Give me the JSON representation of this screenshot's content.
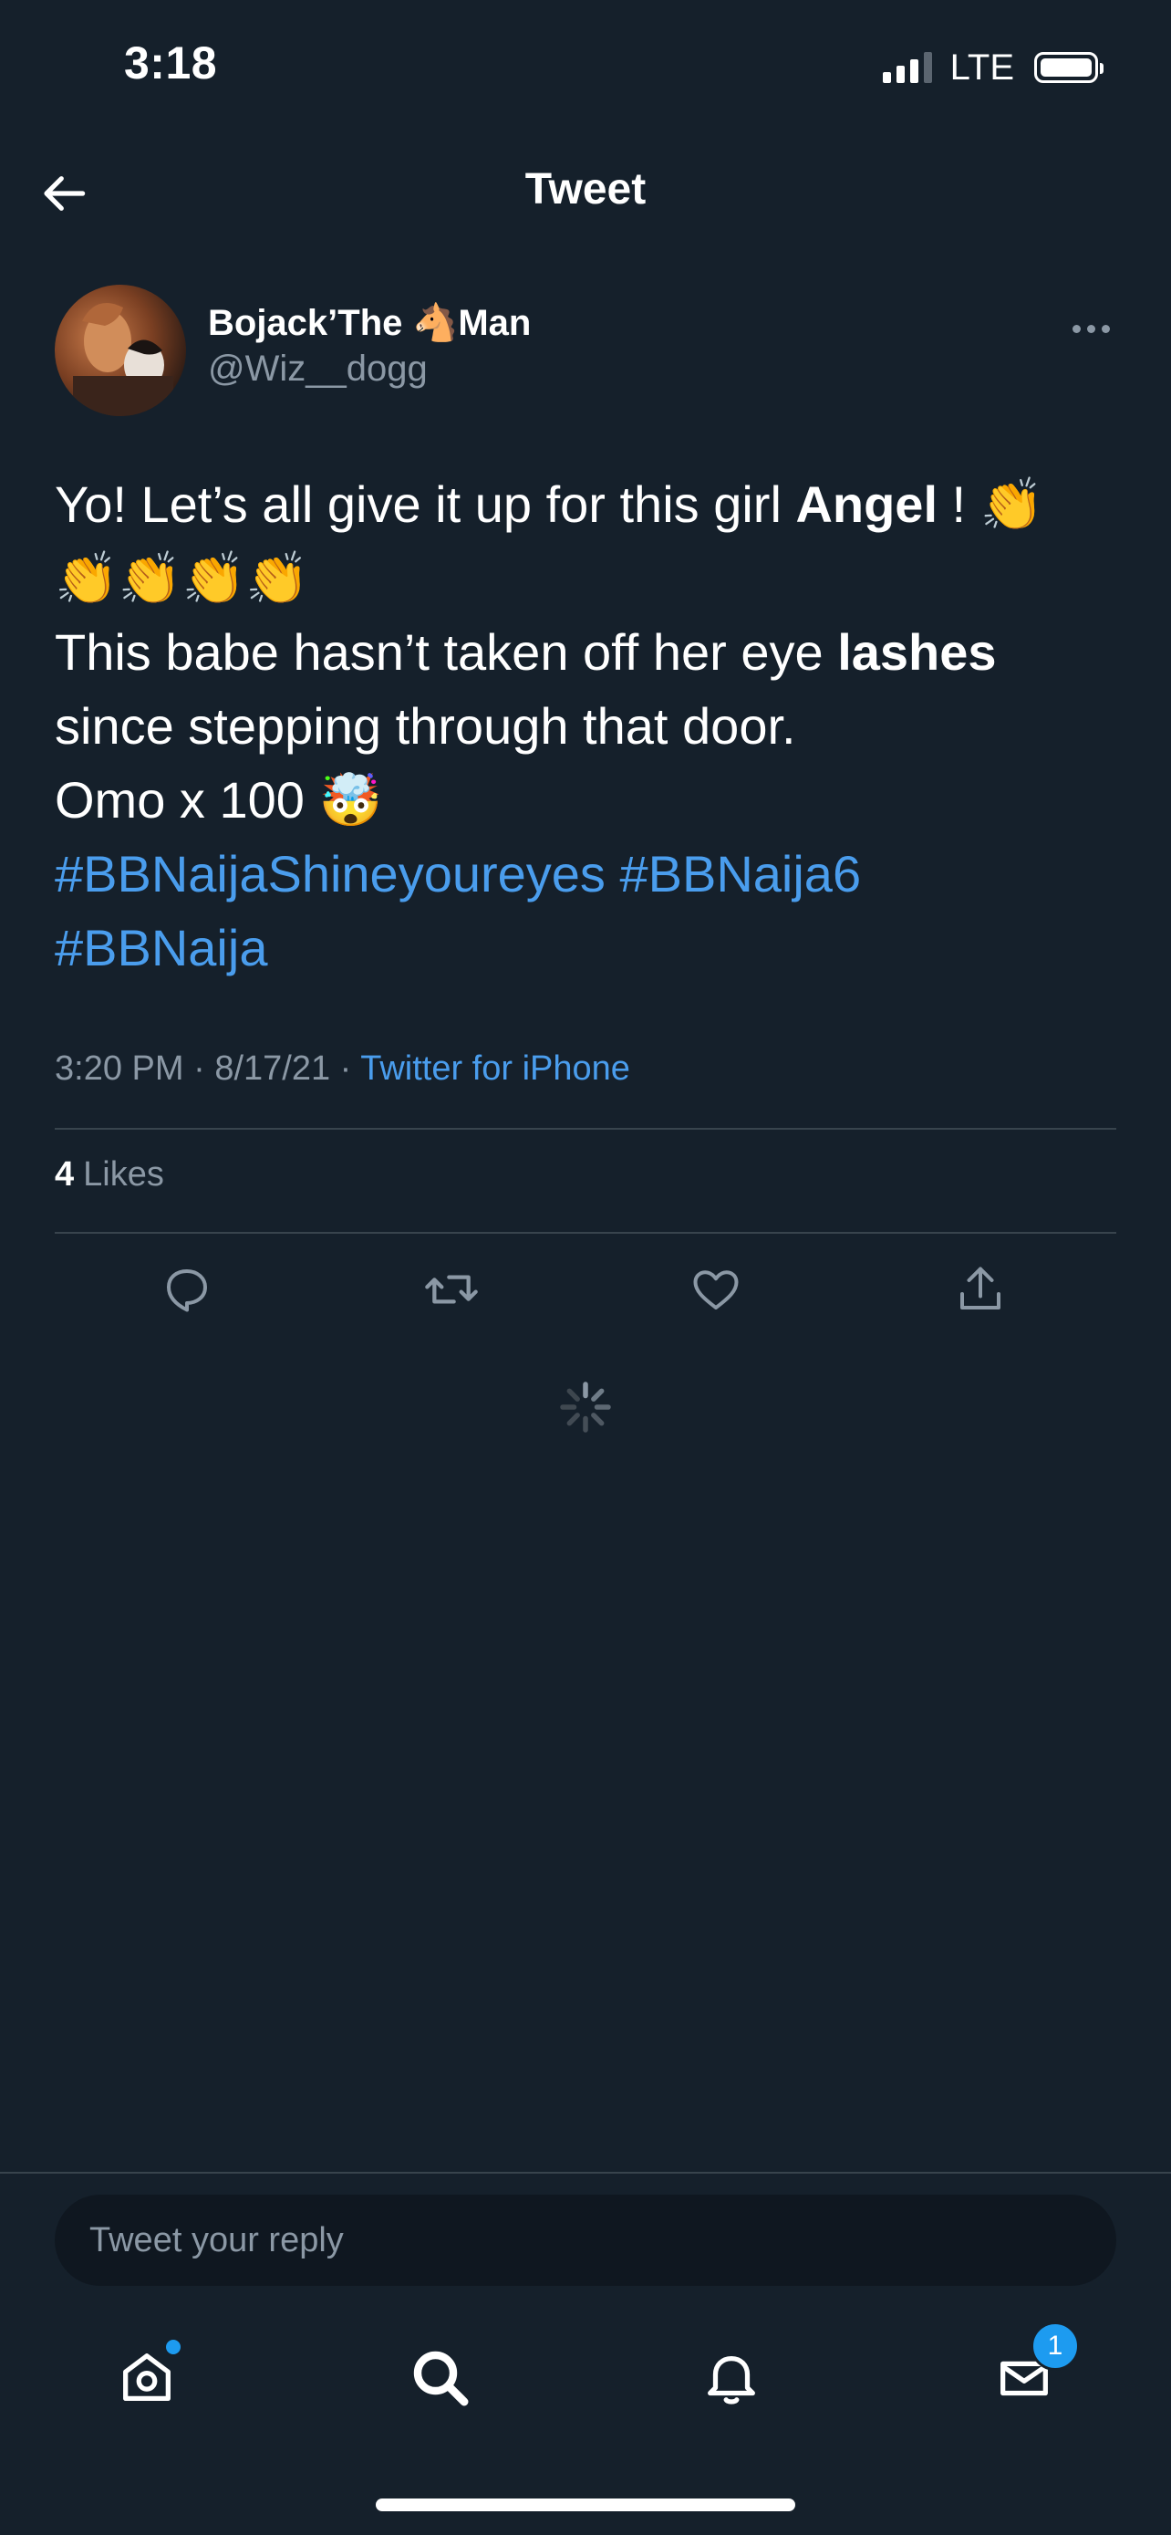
{
  "status_bar": {
    "time": "3:18",
    "network": "LTE"
  },
  "header": {
    "title": "Tweet",
    "back_icon": "arrow-left-icon"
  },
  "tweet": {
    "author": {
      "name_prefix": "Bojack’The ",
      "name_emoji": "🐴",
      "name_suffix": "Man",
      "handle": "@Wiz__dogg"
    },
    "body": {
      "line1_text": "Yo! Let’s all give it up for this girl ",
      "line1_bold": "Angel",
      "line1_end": " ! 👏",
      "line2": "👏👏👏👏",
      "line3_text": "This babe hasn’t taken off her eye ",
      "line3_bold": "lashes",
      "line4": "since stepping through that door.",
      "line5": "Omo x 100 🤯",
      "hashtag1": "#BBNaijaShineyoureyes",
      "hashtag2": "#BBNaija6",
      "hashtag3": "#BBNaija"
    },
    "time": "3:20 PM",
    "separator": " · ",
    "date": "8/17/21",
    "source": "Twitter for iPhone",
    "likes_count": "4",
    "likes_label": "Likes"
  },
  "actions": [
    "reply-icon",
    "retweet-icon",
    "like-icon",
    "share-icon"
  ],
  "reply": {
    "placeholder": "Tweet your reply"
  },
  "tabbar": {
    "items": [
      "home-icon",
      "search-icon",
      "notifications-icon",
      "messages-icon"
    ],
    "messages_badge": "1"
  },
  "colors": {
    "background": "#15202b",
    "accent": "#1d9bf0",
    "link": "#4a9ded",
    "secondary_text": "#8b98a5",
    "divider": "#38444d"
  }
}
